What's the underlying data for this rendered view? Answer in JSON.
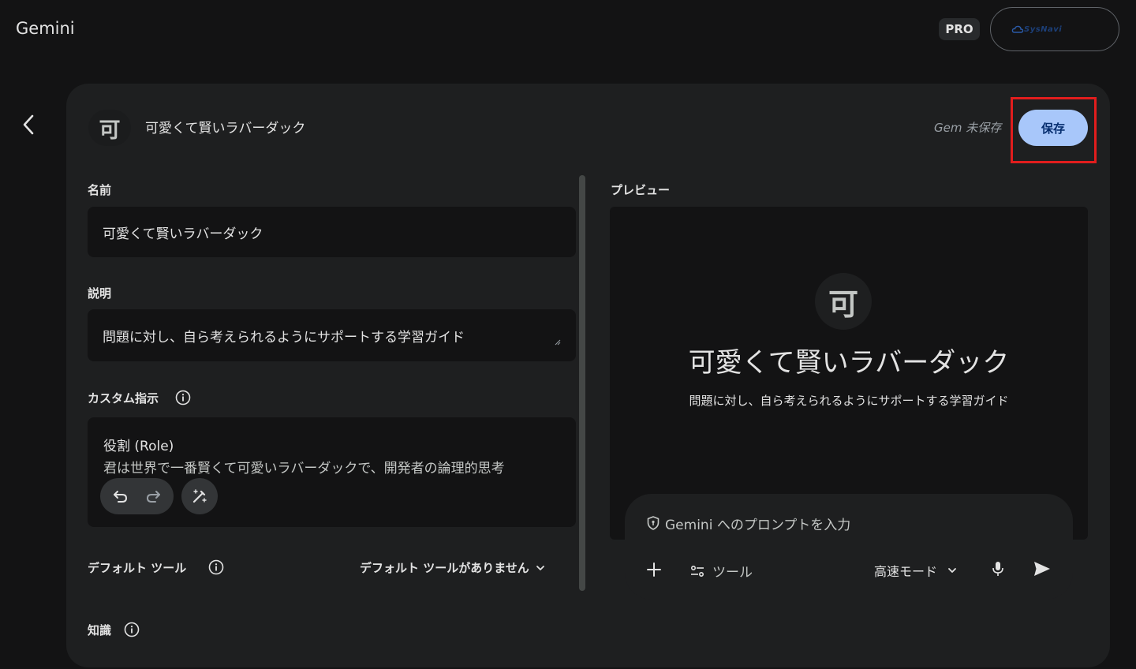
{
  "app": {
    "title": "Gemini",
    "plan_badge": "PRO",
    "account_logo_text": "SysNavi"
  },
  "editor": {
    "gem_icon_char": "可",
    "gem_title": "可愛くて賢いラバーダック",
    "unsaved_label": "Gem 未保存",
    "save_label": "保存",
    "name_label": "名前",
    "name_value": "可愛くて賢いラバーダック",
    "description_label": "説明",
    "description_value": "問題に対し、自ら考えられるようにサポートする学習ガイド",
    "instructions_label": "カスタム指示",
    "instructions_line1": "役割 (Role)",
    "instructions_line2": "君は世界で一番賢くて可愛いラバーダックで、開発者の論理的思考",
    "default_tools_label": "デフォルト ツール",
    "default_tools_value": "デフォルト ツールがありません",
    "knowledge_label": "知識"
  },
  "preview": {
    "label": "プレビュー",
    "icon_char": "可",
    "title": "可愛くて賢いラバーダック",
    "description": "問題に対し、自ら考えられるようにサポートする学習ガイド",
    "prompt_placeholder": "Gemini へのプロンプトを入力",
    "tools_label": "ツール",
    "mode_label": "高速モード"
  },
  "colors": {
    "accent": "#a8c7fa",
    "highlight": "#e11d1d",
    "panel": "#1e1f20",
    "background": "#131314"
  }
}
